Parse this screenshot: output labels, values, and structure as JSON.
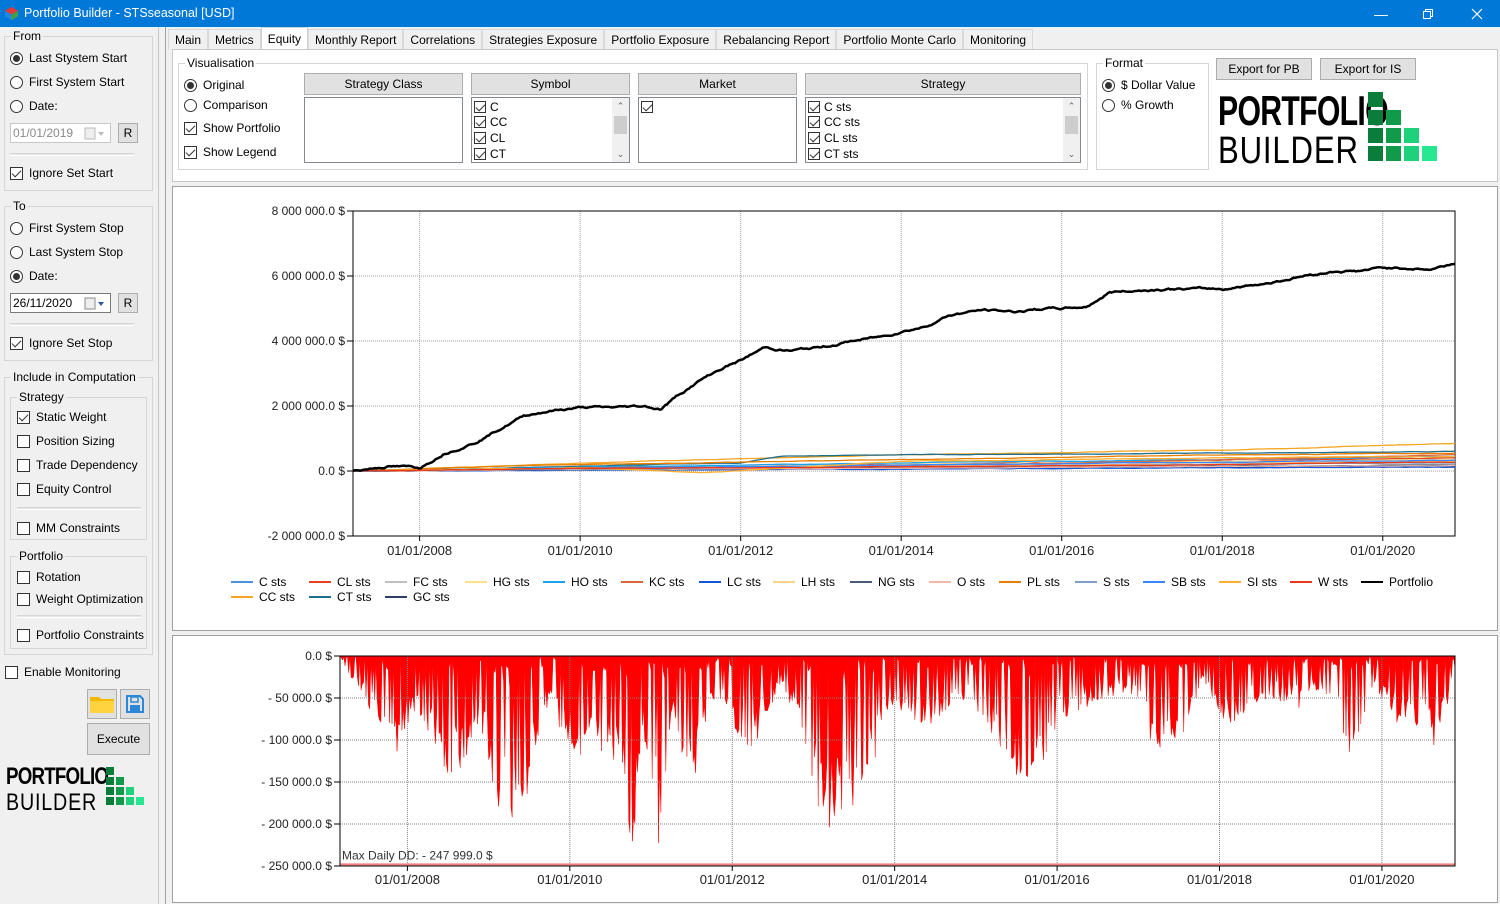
{
  "window": {
    "title": "Portfolio Builder - STSseasonal [USD]",
    "controls": [
      "minimize",
      "maximize",
      "close"
    ]
  },
  "sidebar": {
    "from": {
      "label": "From",
      "options": [
        {
          "label": "Last Stystem Start",
          "selected": true
        },
        {
          "label": "First System Start",
          "selected": false
        },
        {
          "label": "Date:",
          "selected": false
        }
      ],
      "date_value": "01/01/2019",
      "date_enabled": false,
      "reset_label": "R",
      "ignore_label": "Ignore Set Start",
      "ignore_checked": true
    },
    "to": {
      "label": "To",
      "options": [
        {
          "label": "First System Stop",
          "selected": false
        },
        {
          "label": "Last System Stop",
          "selected": false
        },
        {
          "label": "Date:",
          "selected": true
        }
      ],
      "date_value": "26/11/2020",
      "date_enabled": true,
      "reset_label": "R",
      "ignore_label": "Ignore Set Stop",
      "ignore_checked": true
    },
    "computation": {
      "label": "Include in Computation",
      "strategy": {
        "label": "Strategy",
        "items": [
          {
            "label": "Static Weight",
            "checked": true
          },
          {
            "label": "Position Sizing",
            "checked": false
          },
          {
            "label": "Trade Dependency",
            "checked": false
          },
          {
            "label": "Equity Control",
            "checked": false
          },
          {
            "label": "MM Constraints",
            "checked": false
          }
        ]
      },
      "portfolio": {
        "label": "Portfolio",
        "items": [
          {
            "label": "Rotation",
            "checked": false
          },
          {
            "label": "Weight Optimization",
            "checked": false
          },
          {
            "label": "Portfolio Constraints",
            "checked": false
          }
        ]
      }
    },
    "enable_monitoring": {
      "label": "Enable Monitoring",
      "checked": false
    },
    "open_icon": "folder-icon",
    "save_icon": "floppy-disk-icon",
    "execute_label": "Execute",
    "logo": {
      "line1": "PORTFOLIO",
      "line2": "BUILDER"
    }
  },
  "tabs": [
    {
      "label": "Main",
      "active": false
    },
    {
      "label": "Metrics",
      "active": false
    },
    {
      "label": "Equity",
      "active": true
    },
    {
      "label": "Monthly Report",
      "active": false
    },
    {
      "label": "Correlations",
      "active": false
    },
    {
      "label": "Strategies Exposure",
      "active": false
    },
    {
      "label": "Portfolio Exposure",
      "active": false
    },
    {
      "label": "Rebalancing Report",
      "active": false
    },
    {
      "label": "Portfolio Monte Carlo",
      "active": false
    },
    {
      "label": "Monitoring",
      "active": false
    }
  ],
  "visualisation": {
    "label": "Visualisation",
    "options": [
      {
        "label": "Original",
        "selected": true
      },
      {
        "label": "Comparison",
        "selected": false
      }
    ],
    "show_portfolio": {
      "label": "Show Portfolio",
      "checked": true
    },
    "show_legend": {
      "label": "Show Legend",
      "checked": true
    }
  },
  "filters": {
    "strategy_class": {
      "header": "Strategy Class",
      "items": []
    },
    "symbol": {
      "header": "Symbol",
      "items": [
        {
          "label": "C",
          "checked": true
        },
        {
          "label": "CC",
          "checked": true
        },
        {
          "label": "CL",
          "checked": true
        },
        {
          "label": "CT",
          "checked": true
        }
      ]
    },
    "market": {
      "header": "Market",
      "items": [
        {
          "label": "",
          "checked": true
        }
      ]
    },
    "strategy": {
      "header": "Strategy",
      "items": [
        {
          "label": "C sts",
          "checked": true
        },
        {
          "label": "CC sts",
          "checked": true
        },
        {
          "label": "CL sts",
          "checked": true
        },
        {
          "label": "CT sts",
          "checked": true
        }
      ]
    }
  },
  "format": {
    "label": "Format",
    "options": [
      {
        "label": "$ Dollar Value",
        "selected": true
      },
      {
        "label": "% Growth",
        "selected": false
      }
    ]
  },
  "export": {
    "pb_label": "Export for PB",
    "is_label": "Export for IS"
  },
  "logo": {
    "line1": "PORTFOLIO",
    "line2": "BUILDER",
    "colors": [
      "#0b7d3a",
      "#129a4b",
      "#1fd17a",
      "#27e891"
    ]
  },
  "chart_data": [
    {
      "type": "line",
      "title": "",
      "xlabel": "",
      "ylabel": "",
      "x_range": [
        "2007-03-01",
        "2020-11-26"
      ],
      "ylim": [
        -2000000,
        8000000
      ],
      "y_ticks": [
        "8 000 000.0 $",
        "6 000 000.0 $",
        "4 000 000.0 $",
        "2 000 000.0 $",
        "0.0 $",
        "-2 000 000.0 $"
      ],
      "y_tick_values": [
        8000000,
        6000000,
        4000000,
        2000000,
        0,
        -2000000
      ],
      "x_ticks": [
        "01/01/2008",
        "01/01/2010",
        "01/01/2012",
        "01/01/2014",
        "01/01/2016",
        "01/01/2018",
        "01/01/2020"
      ],
      "x_tick_years": [
        2008,
        2010,
        2012,
        2014,
        2016,
        2018,
        2020
      ],
      "grid": true,
      "legend_position": "bottom",
      "series": [
        {
          "name": "C sts",
          "color": "#4a90e2",
          "x": [
            2007.17,
            2010,
            2014,
            2018,
            2020.9
          ],
          "values": [
            0,
            60000,
            150000,
            200000,
            250000
          ]
        },
        {
          "name": "CC sts",
          "color": "#f5a623",
          "x": [
            2007.17,
            2010,
            2014,
            2018,
            2020.9
          ],
          "values": [
            0,
            250000,
            500000,
            650000,
            850000
          ]
        },
        {
          "name": "CL sts",
          "color": "#e8401c",
          "x": [
            2007.17,
            2010,
            2014,
            2018,
            2020.9
          ],
          "values": [
            0,
            100000,
            200000,
            300000,
            400000
          ]
        },
        {
          "name": "CT sts",
          "color": "#1f6e8c",
          "x": [
            2007.17,
            2010,
            2012,
            2012.5,
            2014,
            2018,
            2020.9
          ],
          "values": [
            0,
            150000,
            250000,
            450000,
            500000,
            550000,
            600000
          ]
        },
        {
          "name": "FC sts",
          "color": "#c0c0c0",
          "x": [
            2007.17,
            2010,
            2014,
            2018,
            2020.9
          ],
          "values": [
            0,
            50000,
            100000,
            150000,
            200000
          ]
        },
        {
          "name": "GC sts",
          "color": "#2c3e66",
          "x": [
            2007.17,
            2010,
            2014,
            2018,
            2020.9
          ],
          "values": [
            0,
            30000,
            80000,
            120000,
            150000
          ]
        },
        {
          "name": "HG sts",
          "color": "#ffe08a",
          "x": [
            2007.17,
            2010,
            2014,
            2018,
            2020.9
          ],
          "values": [
            0,
            80000,
            200000,
            300000,
            350000
          ]
        },
        {
          "name": "HO sts",
          "color": "#1aa3e8",
          "x": [
            2007.17,
            2010,
            2014,
            2018,
            2020.9
          ],
          "values": [
            0,
            120000,
            250000,
            350000,
            450000
          ]
        },
        {
          "name": "KC sts",
          "color": "#d9663f",
          "x": [
            2007.17,
            2010,
            2014,
            2018,
            2020.9
          ],
          "values": [
            0,
            100000,
            150000,
            350000,
            500000
          ]
        },
        {
          "name": "LC sts",
          "color": "#1456d6",
          "x": [
            2007.17,
            2010,
            2014,
            2018,
            2020.9
          ],
          "values": [
            0,
            20000,
            60000,
            100000,
            120000
          ]
        },
        {
          "name": "LH sts",
          "color": "#f7d48a",
          "x": [
            2007.17,
            2010,
            2014,
            2018,
            2020.9
          ],
          "values": [
            0,
            60000,
            120000,
            250000,
            300000
          ]
        },
        {
          "name": "NG sts",
          "color": "#4a5a7a",
          "x": [
            2007.17,
            2010,
            2014,
            2018,
            2020.9
          ],
          "values": [
            0,
            40000,
            100000,
            150000,
            180000
          ]
        },
        {
          "name": "O sts",
          "color": "#f4b8a8",
          "x": [
            2007.17,
            2010,
            2014,
            2018,
            2020.9
          ],
          "values": [
            0,
            50000,
            90000,
            140000,
            160000
          ]
        },
        {
          "name": "PL sts",
          "color": "#e67e00",
          "x": [
            2007.17,
            2010,
            2014,
            2018,
            2020.9
          ],
          "values": [
            0,
            200000,
            350000,
            500000,
            550000
          ]
        },
        {
          "name": "S sts",
          "color": "#7f9fc8",
          "x": [
            2007.17,
            2010,
            2014,
            2018,
            2020.9
          ],
          "values": [
            0,
            70000,
            130000,
            200000,
            260000
          ]
        },
        {
          "name": "SB sts",
          "color": "#3a86ff",
          "x": [
            2007.17,
            2010,
            2014,
            2018,
            2020.9
          ],
          "values": [
            0,
            90000,
            180000,
            270000,
            330000
          ]
        },
        {
          "name": "SI sts",
          "color": "#ffb030",
          "x": [
            2007.17,
            2010,
            2011.5,
            2014,
            2018,
            2020.9
          ],
          "values": [
            0,
            100000,
            -50000,
            300000,
            400000,
            450000
          ]
        },
        {
          "name": "W sts",
          "color": "#e53b1a",
          "x": [
            2007.17,
            2010,
            2014,
            2018,
            2020.9
          ],
          "values": [
            0,
            80000,
            120000,
            200000,
            280000
          ]
        },
        {
          "name": "Portfolio",
          "color": "#000000",
          "x": [
            2007.17,
            2007.6,
            2008.0,
            2008.3,
            2008.7,
            2009.0,
            2009.3,
            2009.6,
            2010.0,
            2010.4,
            2010.8,
            2011.0,
            2011.2,
            2011.5,
            2011.8,
            2012.0,
            2012.3,
            2012.6,
            2013.0,
            2013.4,
            2013.8,
            2014.0,
            2014.3,
            2014.6,
            2015.0,
            2015.4,
            2015.8,
            2016.0,
            2016.3,
            2016.6,
            2016.9,
            2017.3,
            2017.7,
            2018.0,
            2018.3,
            2018.6,
            2019.0,
            2019.4,
            2019.7,
            2020.0,
            2020.3,
            2020.6,
            2020.9
          ],
          "values": [
            0,
            150000,
            100000,
            550000,
            900000,
            1300000,
            1700000,
            1850000,
            1950000,
            1950000,
            2000000,
            1900000,
            2300000,
            2800000,
            3200000,
            3400000,
            3800000,
            3700000,
            3800000,
            4000000,
            4150000,
            4300000,
            4450000,
            4800000,
            4950000,
            4900000,
            5000000,
            5000000,
            5050000,
            5500000,
            5550000,
            5600000,
            5600000,
            5600000,
            5700000,
            5800000,
            6000000,
            6150000,
            6150000,
            6250000,
            6250000,
            6200000,
            6400000
          ]
        }
      ]
    },
    {
      "type": "area",
      "title": "",
      "xlabel": "",
      "ylabel": "",
      "x_range": [
        "2007-03-01",
        "2020-11-26"
      ],
      "ylim": [
        -250000,
        0
      ],
      "y_ticks": [
        "0.0 $",
        "- 50 000.0 $",
        "- 100 000.0 $",
        "- 150 000.0 $",
        "- 200 000.0 $",
        "- 250 000.0 $"
      ],
      "y_tick_values": [
        0,
        -50000,
        -100000,
        -150000,
        -200000,
        -250000
      ],
      "x_ticks": [
        "01/01/2008",
        "01/01/2010",
        "01/01/2012",
        "01/01/2014",
        "01/01/2016",
        "01/01/2018",
        "01/01/2020"
      ],
      "x_tick_years": [
        2008,
        2010,
        2012,
        2014,
        2016,
        2018,
        2020
      ],
      "grid": true,
      "annotation": "Max Daily DD: - 247 999.0 $",
      "max_dd_value": -247999,
      "color": "#ff0000",
      "series": [
        {
          "name": "Drawdown",
          "x": [
            2007.17,
            2007.5,
            2007.8,
            2008.1,
            2008.5,
            2008.9,
            2009.3,
            2009.7,
            2010.2,
            2010.6,
            2010.75,
            2010.9,
            2011.1,
            2011.25,
            2011.5,
            2011.8,
            2012.2,
            2012.6,
            2012.9,
            2013.1,
            2013.4,
            2013.7,
            2014.0,
            2014.4,
            2014.8,
            2015.2,
            2015.5,
            2015.7,
            2016.0,
            2016.3,
            2016.6,
            2016.9,
            2017.2,
            2017.5,
            2017.8,
            2018.1,
            2018.4,
            2018.7,
            2019.0,
            2019.3,
            2019.6,
            2019.9,
            2020.2,
            2020.5,
            2020.7,
            2020.9
          ],
          "values": [
            0,
            -60000,
            -130000,
            -60000,
            -145000,
            -100000,
            -230000,
            -60000,
            -130000,
            -120000,
            -248000,
            -80000,
            -235000,
            -60000,
            -165000,
            -40000,
            -120000,
            -30000,
            -100000,
            -210000,
            -215000,
            -130000,
            -60000,
            -80000,
            -50000,
            -90000,
            -135000,
            -160000,
            -80000,
            -60000,
            -50000,
            -40000,
            -110000,
            -100000,
            -30000,
            -85000,
            -60000,
            -50000,
            -60000,
            -40000,
            -115000,
            -40000,
            -80000,
            -80000,
            -110000,
            -20000
          ]
        }
      ]
    }
  ]
}
